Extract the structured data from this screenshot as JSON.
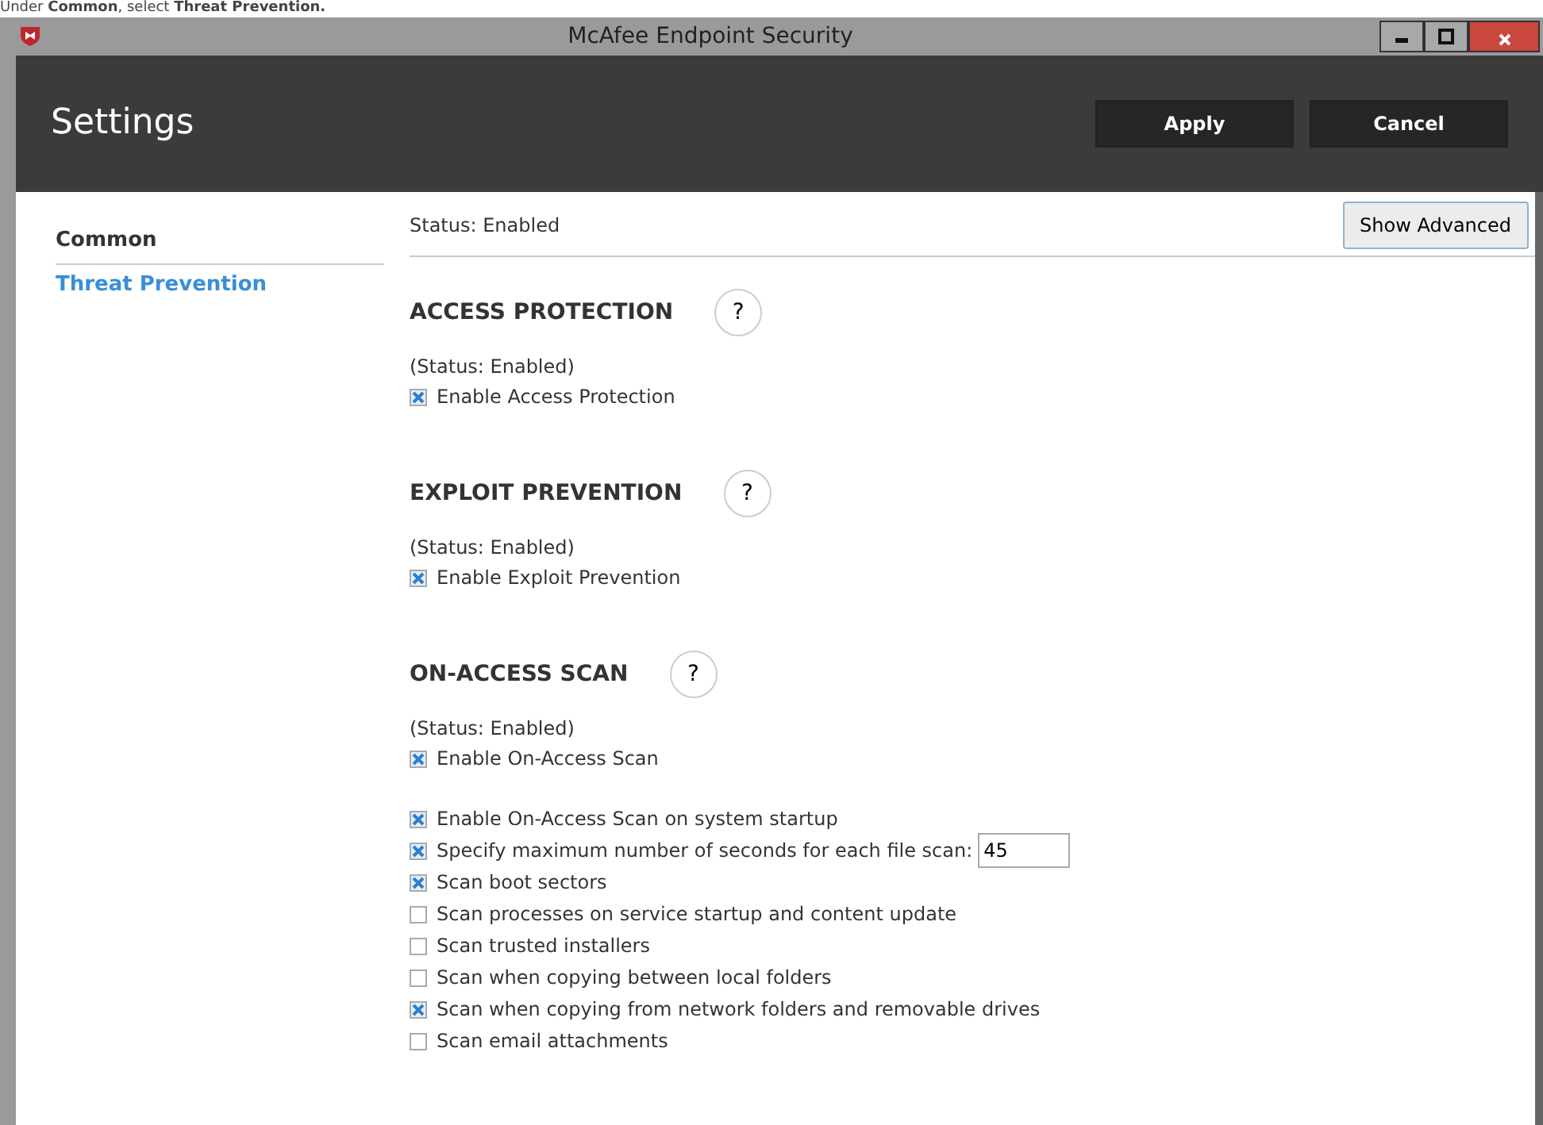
{
  "caption": "Under **Common**, select **Threat Prevention.**",
  "window": {
    "title": "McAfee Endpoint Security"
  },
  "header": {
    "title": "Settings",
    "buttons": [
      "Apply",
      "Cancel"
    ]
  },
  "sidebar": {
    "items": [
      {
        "label": "Common",
        "selected": false
      },
      {
        "label": "Threat Prevention",
        "selected": true
      }
    ]
  },
  "status": "Status: Enabled",
  "show_advanced": "Show Advanced",
  "sections": [
    {
      "title": "ACCESS PROTECTION",
      "help": "?",
      "status": "(Status: Enabled)",
      "enable": {
        "label": "Enable Access Protection",
        "checked": true
      }
    },
    {
      "title": "EXPLOIT PREVENTION",
      "help": "?",
      "status": "(Status: Enabled)",
      "enable": {
        "label": "Enable Exploit Prevention",
        "checked": true
      }
    },
    {
      "title": "ON-ACCESS SCAN",
      "help": "?",
      "status": "(Status: Enabled)",
      "enable": {
        "label": "Enable On-Access Scan",
        "checked": true
      }
    }
  ],
  "options": [
    {
      "label": "Enable On-Access Scan on system startup",
      "checked": true
    },
    {
      "label": "Specify maximum number of seconds for each file scan:",
      "checked": true,
      "value": "45"
    },
    {
      "label": "Scan boot sectors",
      "checked": true
    },
    {
      "label": "Scan processes on service startup and content update",
      "checked": false
    },
    {
      "label": "Scan trusted installers",
      "checked": false
    },
    {
      "label": "Scan when copying between local folders",
      "checked": false
    },
    {
      "label": "Scan when copying from network folders and removable drives",
      "checked": true
    },
    {
      "label": "Scan email attachments",
      "checked": false
    }
  ]
}
